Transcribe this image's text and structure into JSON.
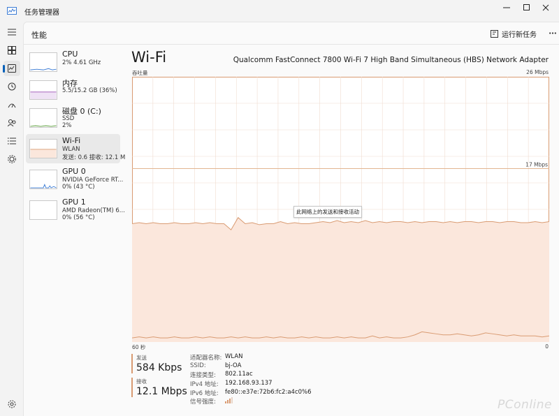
{
  "app": {
    "title": "任务管理器"
  },
  "header": {
    "page_title": "性能",
    "run_task": "运行新任务"
  },
  "nav": {
    "items": [
      {
        "icon": "hamburger-icon"
      },
      {
        "icon": "processes-icon"
      },
      {
        "icon": "performance-icon",
        "active": true
      },
      {
        "icon": "history-icon"
      },
      {
        "icon": "startup-icon"
      },
      {
        "icon": "users-icon"
      },
      {
        "icon": "details-icon"
      },
      {
        "icon": "services-icon"
      },
      {
        "icon": "settings-icon"
      }
    ]
  },
  "devices": [
    {
      "name": "CPU",
      "sub1": "2%  4.61 GHz",
      "sub2": ""
    },
    {
      "name": "内存",
      "sub1": "5.5/15.2 GB (36%)",
      "sub2": ""
    },
    {
      "name": "磁盘 0 (C:)",
      "sub1": "SSD",
      "sub2": "2%"
    },
    {
      "name": "Wi-Fi",
      "sub1": "WLAN",
      "sub2": "发送: 0.6  接收: 12.1 M"
    },
    {
      "name": "GPU 0",
      "sub1": "NVIDIA GeForce RT...",
      "sub2": "0% (43 °C)"
    },
    {
      "name": "GPU 1",
      "sub1": "AMD Radeon(TM) 6...",
      "sub2": "0% (56 °C)"
    }
  ],
  "main": {
    "title": "Wi-Fi",
    "adapter": "Qualcomm FastConnect 7800 Wi-Fi 7 High Band Simultaneous (HBS) Network Adapter",
    "throughput_label": "吞吐量",
    "max_label": "26 Mbps",
    "mid_label": "17 Mbps",
    "x_left": "60 秒",
    "x_right": "0",
    "tooltip": "此网络上的发送和接收活动",
    "send_label": "发送",
    "send_value": "584 Kbps",
    "recv_label": "接收",
    "recv_value": "12.1 Mbps"
  },
  "props": [
    {
      "k": "适配器名称:",
      "v": "WLAN"
    },
    {
      "k": "SSID:",
      "v": "bj-OA"
    },
    {
      "k": "连接类型:",
      "v": "802.11ac"
    },
    {
      "k": "IPv4 地址:",
      "v": "192.168.93.137"
    },
    {
      "k": "IPv6 地址:",
      "v": "fe80::e37e:72b6:fc2:a4c0%6"
    },
    {
      "k": "信号强度:",
      "v": ""
    }
  ],
  "chart_data": {
    "type": "area",
    "x_range": [
      60,
      0
    ],
    "ylim": [
      0,
      26
    ],
    "y_unit": "Mbps",
    "series": [
      {
        "name": "接收",
        "values": [
          11.6,
          11.7,
          11.6,
          11.7,
          11.6,
          11.6,
          11.7,
          11.6,
          11.6,
          11.7,
          11.6,
          11.7,
          11.6,
          11.6,
          11.0,
          12.2,
          11.6,
          11.7,
          11.5,
          11.6,
          11.6,
          11.8,
          11.6,
          11.7,
          11.6,
          11.6,
          11.7,
          11.8,
          11.7,
          11.9,
          11.7,
          11.8,
          11.7,
          11.9,
          11.7,
          11.8,
          11.7,
          11.8,
          11.8,
          11.7,
          11.8,
          11.7,
          11.8,
          11.8,
          11.7,
          11.8,
          11.7,
          11.8,
          11.8,
          11.7,
          11.8,
          11.8,
          11.7,
          11.8,
          11.8,
          11.7,
          11.7,
          11.8,
          11.7,
          11.8
        ]
      },
      {
        "name": "发送",
        "values": [
          0.4,
          0.5,
          0.4,
          0.5,
          0.4,
          0.4,
          0.5,
          0.4,
          0.4,
          0.5,
          0.4,
          0.5,
          0.4,
          0.4,
          0.5,
          0.4,
          0.5,
          0.4,
          0.4,
          0.5,
          0.4,
          0.5,
          0.4,
          0.4,
          0.5,
          0.4,
          0.5,
          0.4,
          0.4,
          0.5,
          0.4,
          0.5,
          0.4,
          0.4,
          0.6,
          0.4,
          0.5,
          0.4,
          0.4,
          0.5,
          0.7,
          1.0,
          0.9,
          0.8,
          0.7,
          0.7,
          0.8,
          0.7,
          0.6,
          0.7,
          0.9,
          0.8,
          0.7,
          0.6,
          0.7,
          0.6,
          0.6,
          0.6,
          0.5,
          0.6
        ]
      }
    ],
    "ref_line": 17
  },
  "colors": {
    "accent": "#d99b72",
    "fill": "#fbe7dc",
    "grid": "#f0dcd0"
  },
  "watermark": "PConline"
}
